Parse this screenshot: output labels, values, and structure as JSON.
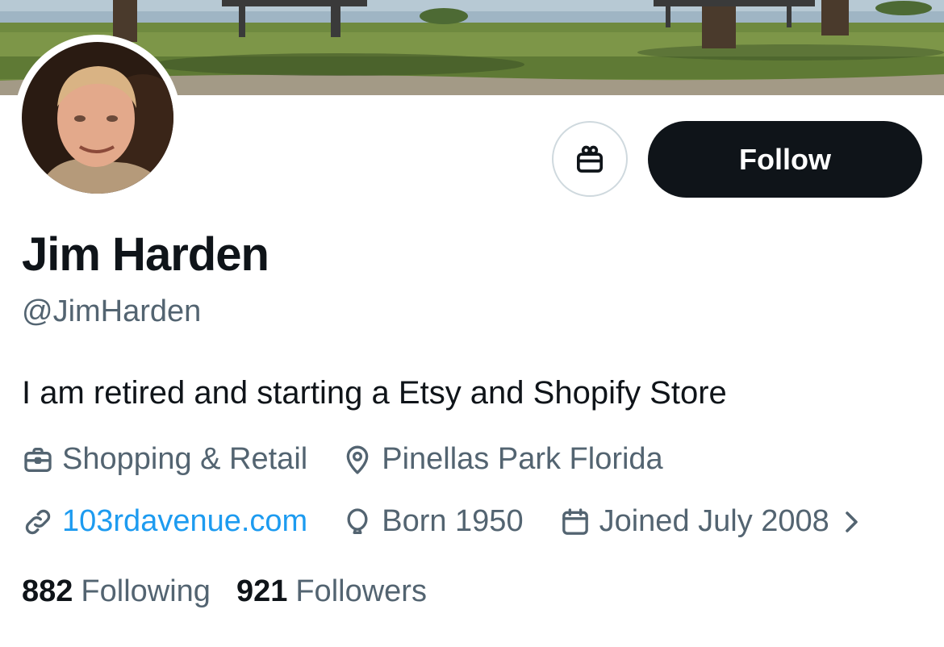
{
  "profile": {
    "name": "Jim Harden",
    "handle": "@JimHarden",
    "bio": "I am retired and starting a Etsy and Shopify Store",
    "category": "Shopping & Retail",
    "location": "Pinellas Park Florida",
    "website": "103rdavenue.com",
    "born": "Born 1950",
    "joined": "Joined July 2008"
  },
  "actions": {
    "follow_label": "Follow",
    "gift_icon": "gift-icon"
  },
  "stats": {
    "following_count": "882",
    "following_label": "Following",
    "followers_count": "921",
    "followers_label": "Followers"
  },
  "colors": {
    "text_primary": "#0f1419",
    "text_secondary": "#536471",
    "link": "#1d9bf0",
    "follow_button": "#0f1419",
    "border": "#cfd9de"
  }
}
